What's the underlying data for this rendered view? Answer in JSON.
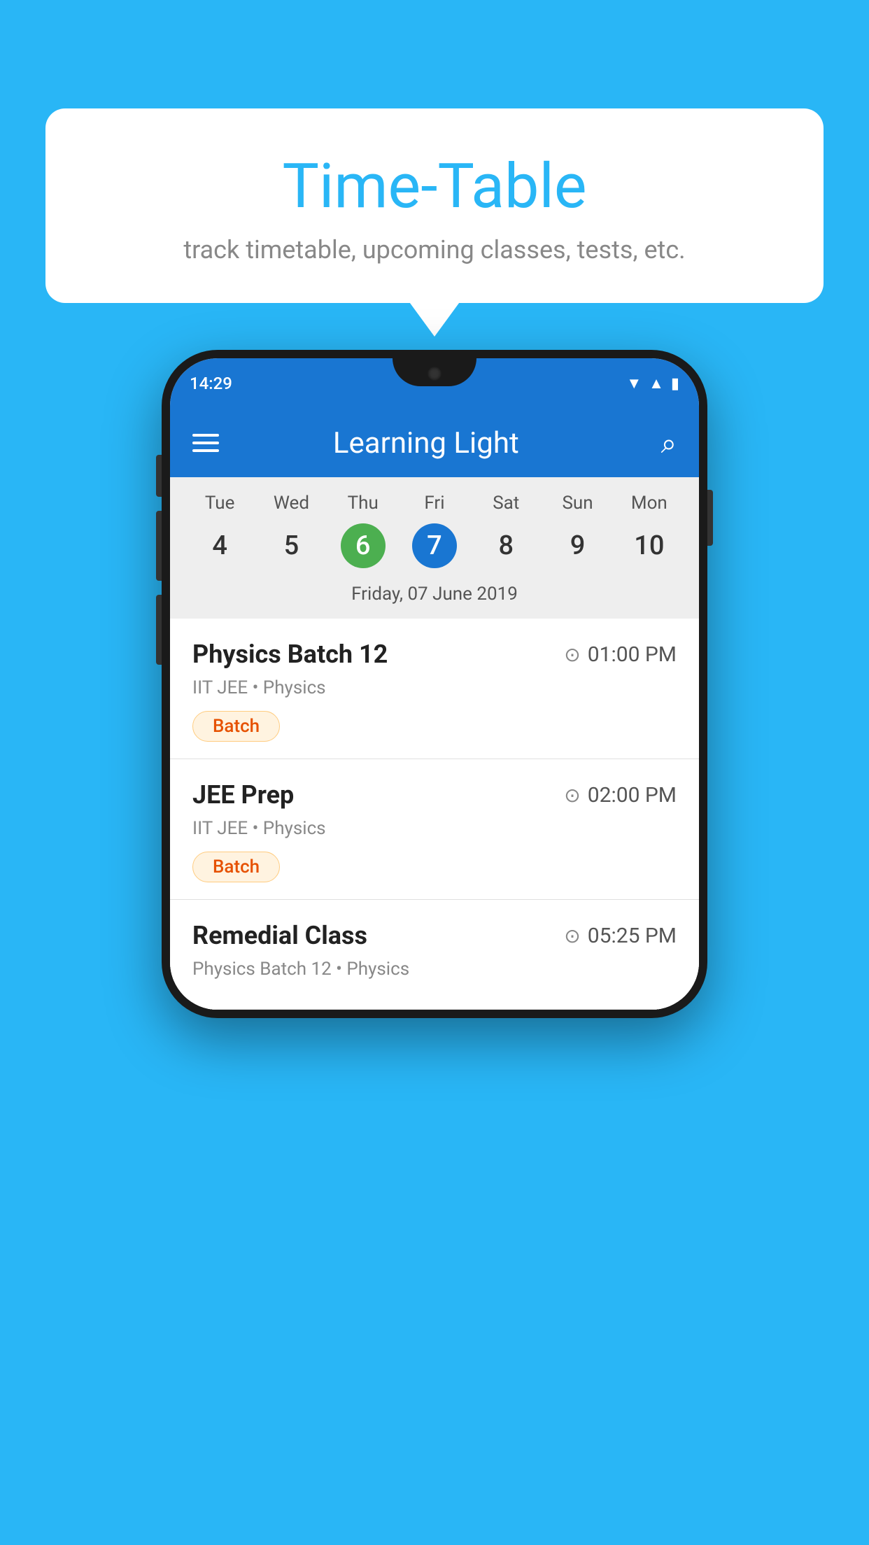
{
  "background_color": "#29B6F6",
  "bubble": {
    "title": "Time-Table",
    "subtitle": "track timetable, upcoming classes, tests, etc."
  },
  "app": {
    "app_name": "Learning Light",
    "status_time": "14:29"
  },
  "calendar": {
    "days": [
      {
        "name": "Tue",
        "number": "4",
        "state": "normal"
      },
      {
        "name": "Wed",
        "number": "5",
        "state": "normal"
      },
      {
        "name": "Thu",
        "number": "6",
        "state": "today"
      },
      {
        "name": "Fri",
        "number": "7",
        "state": "selected"
      },
      {
        "name": "Sat",
        "number": "8",
        "state": "normal"
      },
      {
        "name": "Sun",
        "number": "9",
        "state": "normal"
      },
      {
        "name": "Mon",
        "number": "10",
        "state": "normal"
      }
    ],
    "selected_date": "Friday, 07 June 2019"
  },
  "events": [
    {
      "title": "Physics Batch 12",
      "time": "01:00 PM",
      "meta": "IIT JEE • Physics",
      "badge": "Batch"
    },
    {
      "title": "JEE Prep",
      "time": "02:00 PM",
      "meta": "IIT JEE • Physics",
      "badge": "Batch"
    },
    {
      "title": "Remedial Class",
      "time": "05:25 PM",
      "meta": "Physics Batch 12 • Physics",
      "badge": null
    }
  ],
  "icons": {
    "menu": "☰",
    "search": "🔍",
    "clock": "🕐"
  }
}
